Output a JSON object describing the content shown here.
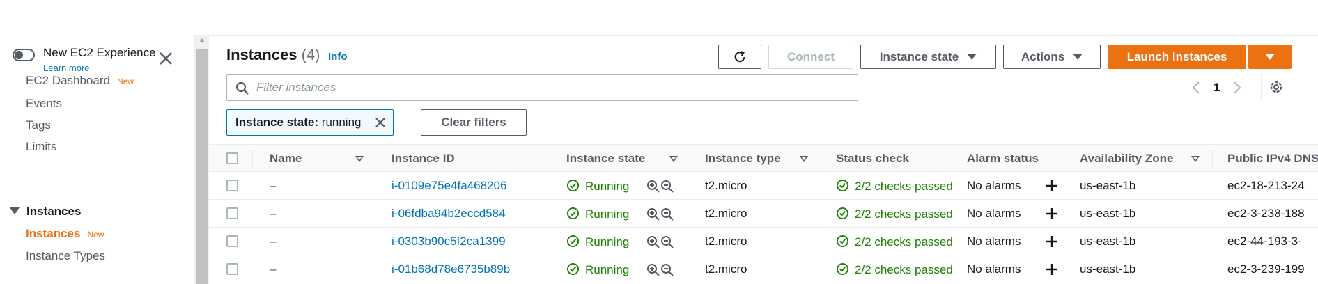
{
  "sidebar": {
    "toggle_title": "New EC2 Experience",
    "learn_more": "Learn more",
    "items": [
      {
        "label": "EC2 Dashboard",
        "badge": "New"
      },
      {
        "label": "Events"
      },
      {
        "label": "Tags"
      },
      {
        "label": "Limits"
      }
    ],
    "section": "Instances",
    "sub_items": [
      {
        "label": "Instances",
        "badge": "New"
      },
      {
        "label": "Instance Types"
      }
    ]
  },
  "header": {
    "title": "Instances",
    "count": "(4)",
    "info": "Info",
    "connect_label": "Connect",
    "instance_state_label": "Instance state",
    "actions_label": "Actions",
    "launch_label": "Launch instances"
  },
  "search": {
    "placeholder": "Filter instances"
  },
  "pagination": {
    "page": "1"
  },
  "filter_token": {
    "key": "Instance state:",
    "value": "running"
  },
  "clear_filters": "Clear filters",
  "table": {
    "columns": [
      "Name",
      "Instance ID",
      "Instance state",
      "Instance type",
      "Status check",
      "Alarm status",
      "Availability Zone",
      "Public IPv4 DNS"
    ],
    "rows": [
      {
        "name": "–",
        "id": "i-0109e75e4fa468206",
        "state": "Running",
        "type": "t2.micro",
        "status": "2/2 checks passed",
        "alarm": "No alarms",
        "az": "us-east-1b",
        "dns": "ec2-18-213-24"
      },
      {
        "name": "–",
        "id": "i-06fdba94b2eccd584",
        "state": "Running",
        "type": "t2.micro",
        "status": "2/2 checks passed",
        "alarm": "No alarms",
        "az": "us-east-1b",
        "dns": "ec2-3-238-188"
      },
      {
        "name": "–",
        "id": "i-0303b90c5f2ca1399",
        "state": "Running",
        "type": "t2.micro",
        "status": "2/2 checks passed",
        "alarm": "No alarms",
        "az": "us-east-1b",
        "dns": "ec2-44-193-3-"
      },
      {
        "name": "–",
        "id": "i-01b68d78e6735b89b",
        "state": "Running",
        "type": "t2.micro",
        "status": "2/2 checks passed",
        "alarm": "No alarms",
        "az": "us-east-1b",
        "dns": "ec2-3-239-199"
      }
    ]
  },
  "colors": {
    "accent": "#ec7211",
    "link": "#0073bb",
    "success": "#1d8102"
  }
}
